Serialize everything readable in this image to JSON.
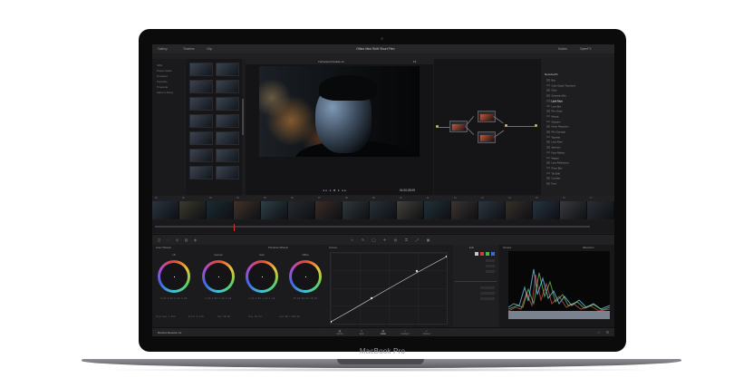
{
  "device": {
    "brand_label": "MacBook Pro"
  },
  "app": {
    "name": "DaVinci Resolve 14",
    "project_title": "Office Mini Shift Short Film",
    "top_left": [
      {
        "label": "Gallery"
      },
      {
        "label": "Timeline"
      },
      {
        "label": "Clip"
      }
    ],
    "top_right": [
      {
        "label": "Nodes"
      },
      {
        "label": "OpenFX"
      }
    ]
  },
  "sidebar": {
    "items": [
      "Stills",
      "Power Grade",
      "Timelines",
      "Favorites",
      "Timecode",
      "Hide in Library"
    ]
  },
  "viewer": {
    "clip_name": "Turnaround Grade v2",
    "timecode": "01:00:25:09",
    "zoom": "Fit"
  },
  "openfx": {
    "title": "ResolveFX",
    "selected": "Light Rays",
    "items": [
      "Blur",
      "Color Space Transform",
      "Glow",
      "Gaussian Blur",
      "Light Rays",
      "Lens Blur",
      "Film Grain",
      "Mosaic",
      "Sharpen",
      "Noise Reduction",
      "Film Damage",
      "Vignette",
      "Lens Flare",
      "Aperture",
      "Face Refiner",
      "Warper",
      "Lens Reflections",
      "Prism Blur",
      "Tilt-Shift",
      "Contrast",
      "Dent"
    ]
  },
  "clips": {
    "labels": [
      "01",
      "02",
      "03",
      "04",
      "05",
      "06",
      "07",
      "08",
      "09",
      "10",
      "11",
      "12",
      "13",
      "14",
      "15",
      "16",
      "17"
    ]
  },
  "color_wheels": {
    "title": "Color Wheels",
    "mode": "Primaries Wheels",
    "wheels": [
      {
        "label": "Lift",
        "values": "0.00 0.00 0.00 0.00"
      },
      {
        "label": "Gamma",
        "values": "0.00 0.00 0.00 0.00"
      },
      {
        "label": "Gain",
        "values": "1.00 1.00 1.00 1.00"
      },
      {
        "label": "Offset",
        "values": "25.00 25.00 25.00"
      }
    ],
    "bottom_labels": [
      "Contrast 1.000",
      "Pivot 0.435",
      "Sat 50.00",
      "Hue 50.00",
      "Lum Mix 100.00"
    ]
  },
  "curves": {
    "title": "Curves",
    "edit_label": "Edit"
  },
  "scope": {
    "title": "Scopes",
    "mode": "Waveform"
  },
  "pages": [
    {
      "label": "Media",
      "icon": "▦"
    },
    {
      "label": "Edit",
      "icon": "≡"
    },
    {
      "label": "Color",
      "icon": "◎"
    },
    {
      "label": "Fairlight",
      "icon": "♫"
    },
    {
      "label": "Deliver",
      "icon": "➶"
    }
  ],
  "colors": {
    "accent_red": "#d2372c",
    "node_connector": "#b7b74a",
    "selected_swatch_red": "#d13b3b",
    "selected_swatch_green": "#3bbf4b",
    "selected_swatch_blue": "#3b6ed1"
  }
}
